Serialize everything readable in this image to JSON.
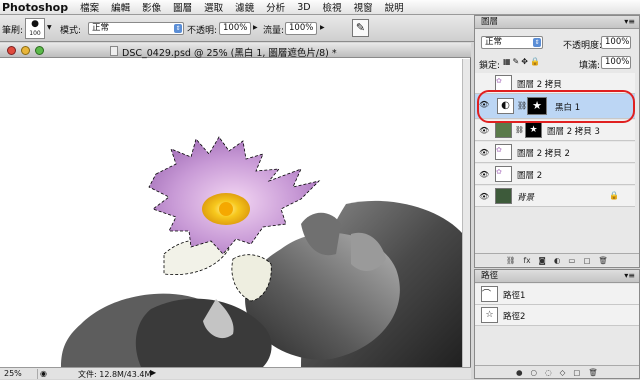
{
  "menubar": {
    "app": "Photoshop",
    "items": [
      "檔案",
      "編輯",
      "影像",
      "圖層",
      "選取",
      "濾鏡",
      "分析",
      "3D",
      "檢視",
      "視窗",
      "說明"
    ]
  },
  "options": {
    "brush_label": "筆刷:",
    "brush_size": "100",
    "mode_label": "模式:",
    "mode_value": "正常",
    "opacity_label": "不透明:",
    "opacity_value": "100%",
    "flow_label": "流量:",
    "flow_value": "100%"
  },
  "document": {
    "title": "DSC_0429.psd @ 25% (黑白 1, 圖層遮色片/8) *",
    "zoom": "25%",
    "doc_size": "文件: 12.8M/43.4M"
  },
  "layers_panel": {
    "tab": "圖層",
    "blend_mode": "正常",
    "opacity_label": "不透明度:",
    "opacity_value": "100%",
    "lock_label": "鎖定:",
    "fill_label": "填滿:",
    "fill_value": "100%",
    "layers": [
      {
        "name": "圖層 2 拷貝",
        "visible": false,
        "selected": false
      },
      {
        "name": "黑白 1",
        "visible": true,
        "selected": true
      },
      {
        "name": "圖層 2 拷貝 3",
        "visible": true,
        "selected": false
      },
      {
        "name": "圖層 2 拷貝 2",
        "visible": true,
        "selected": false
      },
      {
        "name": "圖層 2",
        "visible": true,
        "selected": false
      },
      {
        "name": "背景",
        "visible": true,
        "selected": false
      }
    ]
  },
  "paths_panel": {
    "tab": "路徑",
    "paths": [
      {
        "name": "路徑1"
      },
      {
        "name": "路徑2"
      }
    ]
  },
  "colors": {
    "selection_highlight": "#bcd6f4",
    "annotation_circle": "#e02020",
    "flower": "#c9a0d8",
    "flower_center": "#f5c518"
  }
}
